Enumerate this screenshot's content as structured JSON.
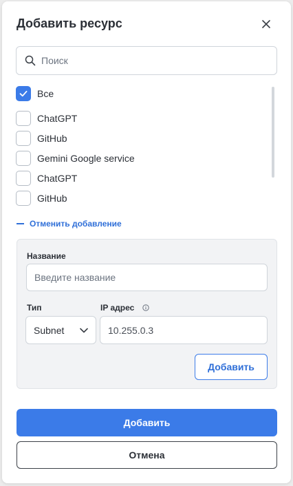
{
  "dialog": {
    "title": "Добавить ресурс",
    "close_icon": "close-icon"
  },
  "search": {
    "placeholder": "Поиск",
    "value": "",
    "icon": "search-icon"
  },
  "resources": {
    "items": [
      {
        "label": "Все",
        "checked": true
      },
      {
        "label": "ChatGPT",
        "checked": false
      },
      {
        "label": "GitHub",
        "checked": false
      },
      {
        "label": "Gemini Google service",
        "checked": false
      },
      {
        "label": "ChatGPT",
        "checked": false
      },
      {
        "label": "GitHub",
        "checked": false
      }
    ]
  },
  "cancel_add_label": "Отменить добавление",
  "form": {
    "name_label": "Название",
    "name_placeholder": "Введите название",
    "type_label": "Тип",
    "type_value": "Subnet",
    "ip_label": "IP адрес",
    "ip_value": "10.255.0.3",
    "add_button": "Добавить"
  },
  "footer": {
    "submit_label": "Добавить",
    "cancel_label": "Отмена"
  },
  "colors": {
    "accent": "#3b7be8",
    "link": "#2f6fd8"
  }
}
